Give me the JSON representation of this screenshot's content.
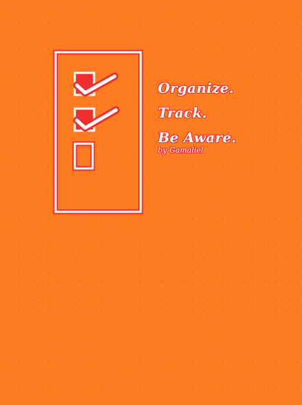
{
  "splash": {
    "logo_icon": "checklist-icon",
    "tagline": {
      "line1": "Organize.",
      "line2": "Track.",
      "line3": "Be Aware."
    },
    "byline": "by Gamaliel"
  },
  "colors": {
    "background": "#fd7c22",
    "accent_red": "#ef2e2e",
    "stroke_white": "#ffffff"
  }
}
